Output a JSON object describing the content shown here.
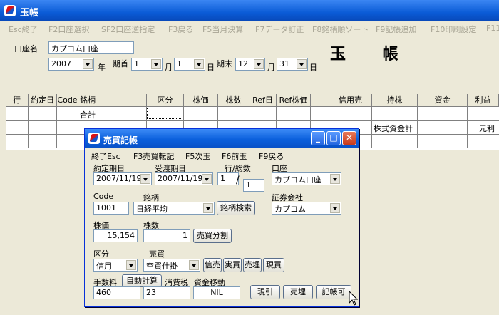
{
  "main": {
    "title": "玉帳",
    "menu": [
      "Esc終了",
      "F2口座選択",
      "SF2口座逆指定",
      "F3戻る",
      "F5当月決算",
      "F7データ訂正",
      "F8銘柄順ソート",
      "F9記帳追加",
      "F10印刷設定",
      "F11"
    ],
    "account_label": "口座名",
    "account_value": "カプコム口座",
    "year_value": "2007",
    "year_unit": "年",
    "start_label": "期首",
    "start_month": "1",
    "month_unit": "月",
    "start_day": "1",
    "day_unit": "日",
    "end_label": "期末",
    "end_month": "12",
    "end_day": "31",
    "book_title": "玉 帳"
  },
  "grid": {
    "headers": [
      "行",
      "約定日",
      "Code",
      "銘柄",
      "区分",
      "株価",
      "株数",
      "Ref日",
      "Ref株価",
      "",
      "信用売",
      "持株",
      "資金",
      "利益"
    ],
    "row1_name": "合計",
    "row2_holding": "株式資金計",
    "row2_profit": "元利"
  },
  "dialog": {
    "title": "売買記帳",
    "menu": [
      "終了Esc",
      "F3売買転記",
      "F5次玉",
      "F6前玉",
      "F9戻る"
    ],
    "trade_date_label": "約定期日",
    "trade_date": "2007/11/19",
    "delivery_date_label": "受渡期日",
    "delivery_date": "2007/11/19",
    "row_total_label": "行/総数",
    "row_value": "1",
    "total_value": "1",
    "account_label": "口座",
    "account_value": "カプコム口座",
    "code_label": "Code",
    "code_value": "1001",
    "brand_label": "銘柄",
    "brand_value": "日経平均",
    "brand_search": "銘柄検索",
    "broker_label": "証券会社",
    "broker_value": "カプコム",
    "price_label": "株価",
    "price_value": "15,154",
    "shares_label": "株数",
    "shares_value": "1",
    "split_button": "売買分割",
    "type_label": "区分",
    "type_value": "信用",
    "trade_label": "売買",
    "trade_value": "空買仕掛",
    "btn_margin_sell": "信売",
    "btn_actual_buy": "実買",
    "btn_actual_sell": "売埋",
    "btn_spot_buy": "現買",
    "fee_label": "手数料",
    "auto_calc": "自動計算",
    "tax_label": "消費税",
    "fund_move_label": "資金移動",
    "fee_value": "460",
    "tax_value": "23",
    "fund_value": "NIL",
    "btn_spot_pull": "現引",
    "btn_sell_close": "売埋",
    "btn_record_ok": "記帳可"
  }
}
